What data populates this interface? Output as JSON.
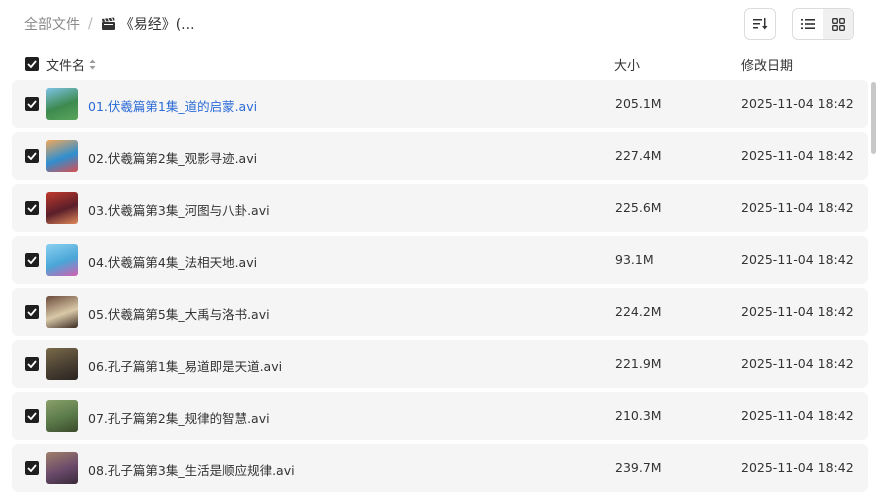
{
  "breadcrumb": {
    "root": "全部文件",
    "separator": "/",
    "current": "《易经》(..."
  },
  "toolbar": {
    "sort_icon": "sort-descending-icon",
    "list_view_icon": "list-view-icon",
    "grid_view_icon": "grid-view-icon",
    "active_view": "list"
  },
  "columns": {
    "name": "文件名",
    "size": "大小",
    "date": "修改日期"
  },
  "files": [
    {
      "name": "01.伏羲篇第1集_道的启蒙.avi",
      "size": "205.1M",
      "date": "2025-11-04 18:42",
      "checked": true,
      "thumb": [
        "#3d8a4f",
        "#7ec3e6",
        "#5aa55c"
      ]
    },
    {
      "name": "02.伏羲篇第2集_观影寻迹.avi",
      "size": "227.4M",
      "date": "2025-11-04 18:42",
      "checked": true,
      "thumb": [
        "#2f8fd0",
        "#f0a85a",
        "#d94f4f"
      ]
    },
    {
      "name": "03.伏羲篇第3集_河图与八卦.avi",
      "size": "225.6M",
      "date": "2025-11-04 18:42",
      "checked": true,
      "thumb": [
        "#5a1e2a",
        "#c0392b",
        "#e08a5a"
      ]
    },
    {
      "name": "04.伏羲篇第4集_法相天地.avi",
      "size": "93.1M",
      "date": "2025-11-04 18:42",
      "checked": true,
      "thumb": [
        "#4aa6d8",
        "#8bd0f0",
        "#d45fb0"
      ]
    },
    {
      "name": "05.伏羲篇第5集_大禹与洛书.avi",
      "size": "224.2M",
      "date": "2025-11-04 18:42",
      "checked": true,
      "thumb": [
        "#d9c9a8",
        "#6b4a3a",
        "#3a2a22"
      ]
    },
    {
      "name": "06.孔子篇第1集_易道即是天道.avi",
      "size": "221.9M",
      "date": "2025-11-04 18:42",
      "checked": true,
      "thumb": [
        "#4a4032",
        "#7a6a4a",
        "#2a2420"
      ]
    },
    {
      "name": "07.孔子篇第2集_规律的智慧.avi",
      "size": "210.3M",
      "date": "2025-11-04 18:42",
      "checked": true,
      "thumb": [
        "#5a7a4a",
        "#8aa06a",
        "#3a4a2a"
      ]
    },
    {
      "name": "08.孔子篇第3集_生活是顺应规律.avi",
      "size": "239.7M",
      "date": "2025-11-04 18:42",
      "checked": true,
      "thumb": [
        "#6a4a6a",
        "#a0806a",
        "#3a2a3a"
      ]
    }
  ]
}
